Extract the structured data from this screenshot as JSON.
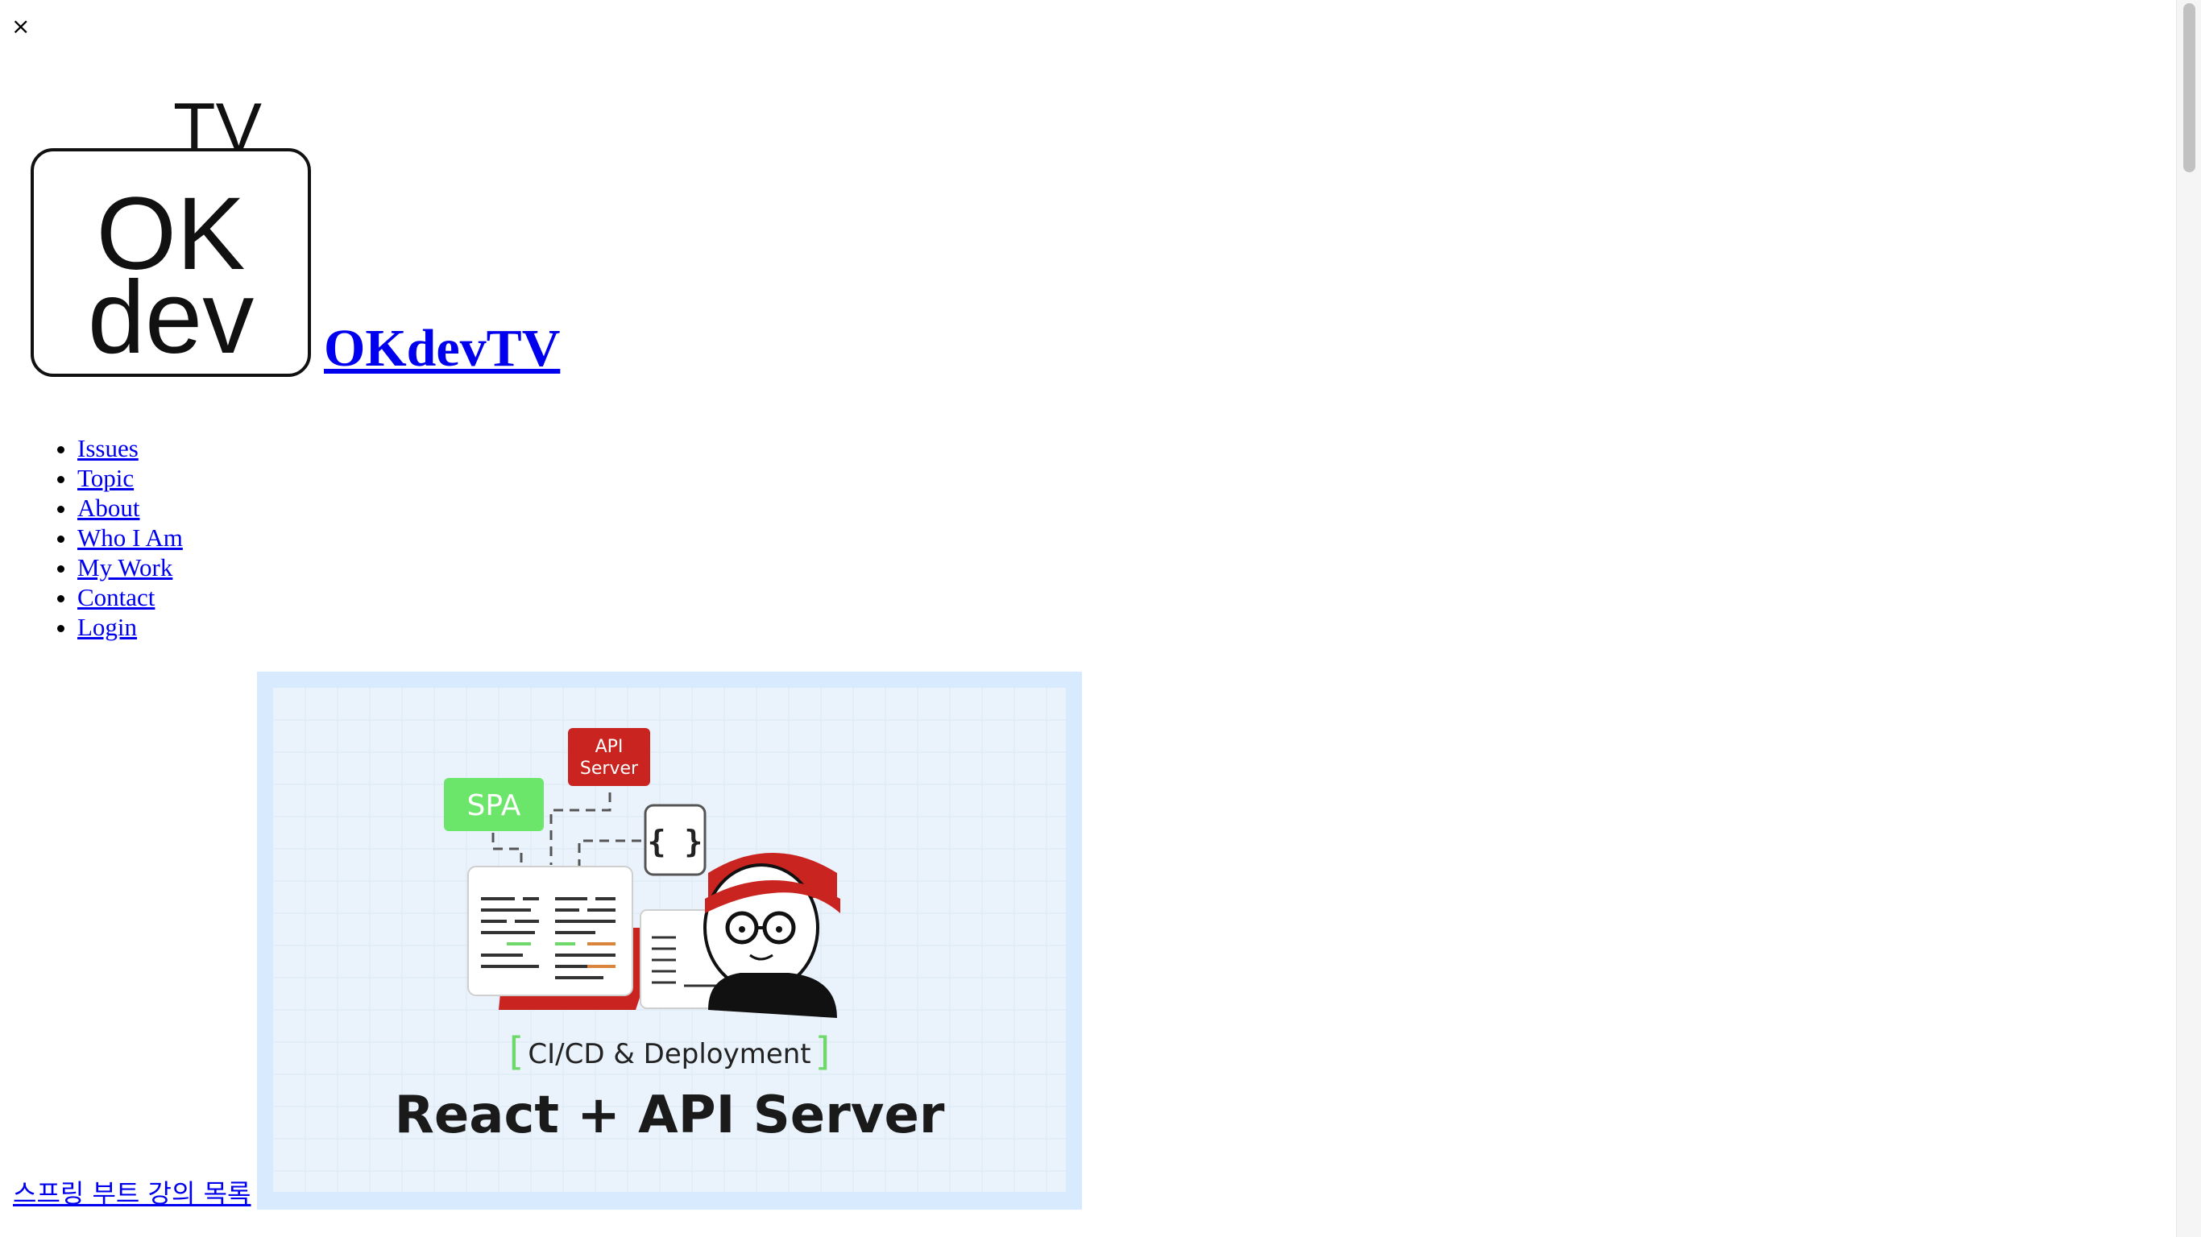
{
  "close": {
    "glyph": "×"
  },
  "site": {
    "title": "OKdevTV",
    "logo": {
      "top_text": "TV",
      "line1": "OK",
      "line2": "dev"
    }
  },
  "nav": {
    "items": [
      {
        "label": "Issues"
      },
      {
        "label": "Topic"
      },
      {
        "label": "About"
      },
      {
        "label": "Who I Am"
      },
      {
        "label": "My Work"
      },
      {
        "label": "Contact"
      },
      {
        "label": "Login"
      }
    ]
  },
  "promo": {
    "link_text": "스프링 부트 강의 목록",
    "banner": {
      "badge_api": [
        "API",
        "Server"
      ],
      "badge_spa": "SPA",
      "braces": "{ }",
      "bracket_left": "[",
      "subtitle": "CI/CD & Deployment",
      "bracket_right": "]",
      "headline": "React + API Server"
    }
  },
  "colors": {
    "link": "#0000ee",
    "banner_border": "#d8eafd",
    "banner_bg": "#eaf3fb",
    "spa_green": "#6ce66a",
    "api_red": "#c9241f",
    "bracket_green": "#6fd86a"
  }
}
